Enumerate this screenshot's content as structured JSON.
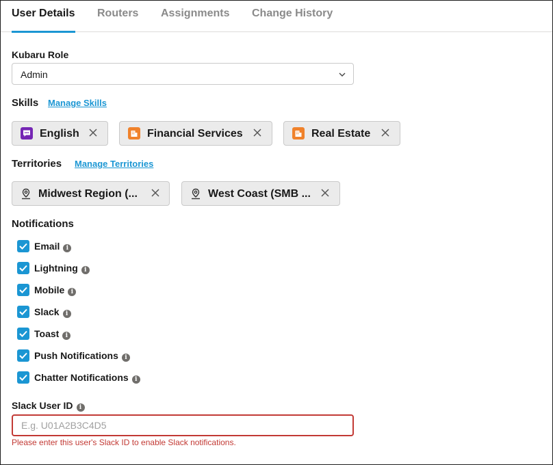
{
  "tabs": [
    {
      "label": "User Details",
      "active": true
    },
    {
      "label": "Routers",
      "active": false
    },
    {
      "label": "Assignments",
      "active": false
    },
    {
      "label": "Change History",
      "active": false
    }
  ],
  "role": {
    "label": "Kubaru Role",
    "value": "Admin"
  },
  "skills": {
    "title": "Skills",
    "manage_link": "Manage Skills",
    "items": [
      {
        "label": "English",
        "icon": "chat-icon",
        "color": "#7526b4"
      },
      {
        "label": "Financial Services",
        "icon": "building-icon",
        "color": "#f0822b"
      },
      {
        "label": "Real Estate",
        "icon": "building-icon",
        "color": "#f0822b"
      }
    ]
  },
  "territories": {
    "title": "Territories",
    "manage_link": "Manage Territories",
    "items": [
      {
        "label": "Midwest Region (...",
        "icon": "location-pin-icon"
      },
      {
        "label": "West Coast (SMB ...",
        "icon": "location-pin-icon"
      }
    ]
  },
  "notifications": {
    "title": "Notifications",
    "items": [
      {
        "label": "Email",
        "checked": true
      },
      {
        "label": "Lightning",
        "checked": true
      },
      {
        "label": "Mobile",
        "checked": true
      },
      {
        "label": "Slack",
        "checked": true
      },
      {
        "label": "Toast",
        "checked": true
      },
      {
        "label": "Push Notifications",
        "checked": true
      },
      {
        "label": "Chatter Notifications",
        "checked": true
      }
    ]
  },
  "slack": {
    "label": "Slack User ID",
    "value": "",
    "placeholder": "E.g. U01A2B3C4D5",
    "error": "Please enter this user's Slack ID to enable Slack notifications."
  },
  "colors": {
    "accent": "#1b96d3",
    "error": "#c23934",
    "skill_purple": "#7526b4",
    "skill_orange": "#f0822b"
  }
}
